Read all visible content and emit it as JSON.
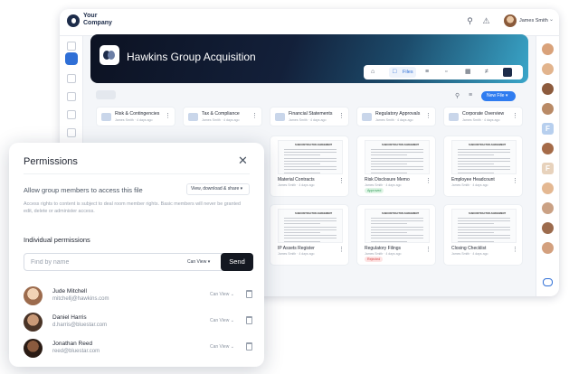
{
  "app": {
    "company_name": "Your Company",
    "user_name": "James Smith",
    "room_title": "Hawkins Group Acquisition",
    "active_tab": "Files",
    "new_file_label": "New File",
    "brand_color": "#2f7cf0",
    "folders": [
      {
        "title": "Risk & Contingencies",
        "meta": "James Smith · 4 days ago"
      },
      {
        "title": "Tax & Compliance",
        "meta": "James Smith · 4 days ago"
      },
      {
        "title": "Financial Statements",
        "meta": "James Smith · 4 days ago"
      },
      {
        "title": "Regulatory Approvals",
        "meta": "James Smith · 4 days ago"
      },
      {
        "title": "Corporate Overview",
        "meta": "James Smith · 4 days ago"
      }
    ],
    "cards_row1": [
      {
        "title": "Material Contracts",
        "meta": "James Smith · 4 days ago",
        "tag": ""
      },
      {
        "title": "Risk Disclosure Memo",
        "meta": "James Smith · 4 days ago",
        "tag": "Approved"
      },
      {
        "title": "Employee Headcount",
        "meta": "James Smith · 4 days ago",
        "tag": ""
      }
    ],
    "cards_row2": [
      {
        "title": "IP Assets Register",
        "meta": "James Smith · 4 days ago",
        "tag": ""
      },
      {
        "title": "Regulatory Filings",
        "meta": "James Smith · 4 days ago",
        "tag": "Rejected"
      },
      {
        "title": "Closing Checklist",
        "meta": "James Smith · 4 days ago",
        "tag": ""
      }
    ],
    "doc_heading": "SUBCONTRACTOR AGREEMENT",
    "right_rail_letter": "F"
  },
  "dialog": {
    "title": "Permissions",
    "close_icon": "close-icon",
    "allow_label": "Allow group members to access this file",
    "access_value": "View, download & share",
    "access_note": "Access rights to content is subject to deal room member rights. Basic members will never be granted edit, delete or administer access.",
    "individual_title": "Individual permissions",
    "search_placeholder": "Find by name",
    "search_role": "Can View",
    "send_label": "Send",
    "members": [
      {
        "name": "Jude Mitchell",
        "email": "mitchellj@hawkins.com",
        "role": "Can View"
      },
      {
        "name": "Daniel Harris",
        "email": "d.harris@bluestar.com",
        "role": "Can View"
      },
      {
        "name": "Jonathan Reed",
        "email": "reed@bluestar.com",
        "role": "Can View"
      }
    ]
  }
}
